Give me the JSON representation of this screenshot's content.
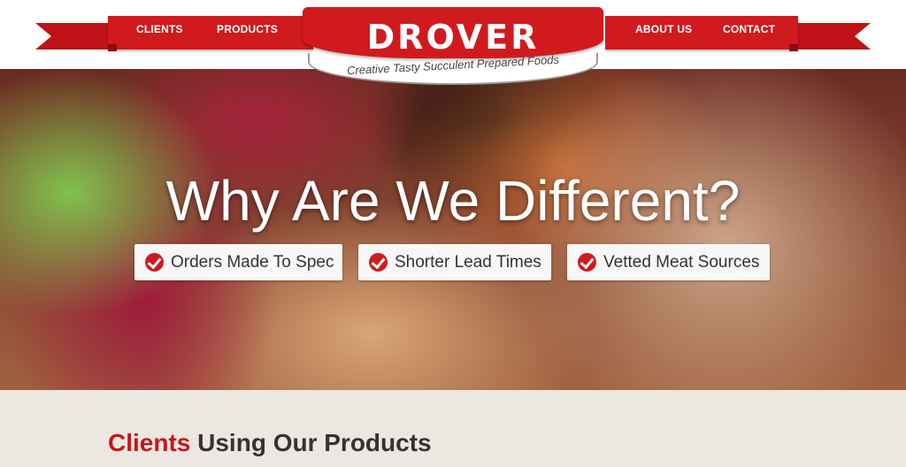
{
  "header": {
    "nav_left": [
      {
        "label": "CLIENTS"
      },
      {
        "label": "PRODUCTS"
      }
    ],
    "nav_right": [
      {
        "label": "ABOUT US"
      },
      {
        "label": "CONTACT"
      }
    ],
    "logo": {
      "text": "DROVER",
      "tagline": "Creative Tasty Succulent Prepared Foods"
    }
  },
  "hero": {
    "title": "Why Are We Different?",
    "badges": [
      {
        "label": "Orders Made To Spec",
        "icon": "check-circle-icon"
      },
      {
        "label": "Shorter Lead Times",
        "icon": "check-circle-icon"
      },
      {
        "label": "Vetted Meat Sources",
        "icon": "check-circle-icon"
      }
    ]
  },
  "clients_section": {
    "title_highlight": "Clients",
    "title_rest": " Using Our Products"
  },
  "colors": {
    "brand_red": "#d11a1e",
    "section_bg": "#ebe7e1",
    "text_dark": "#333333"
  }
}
